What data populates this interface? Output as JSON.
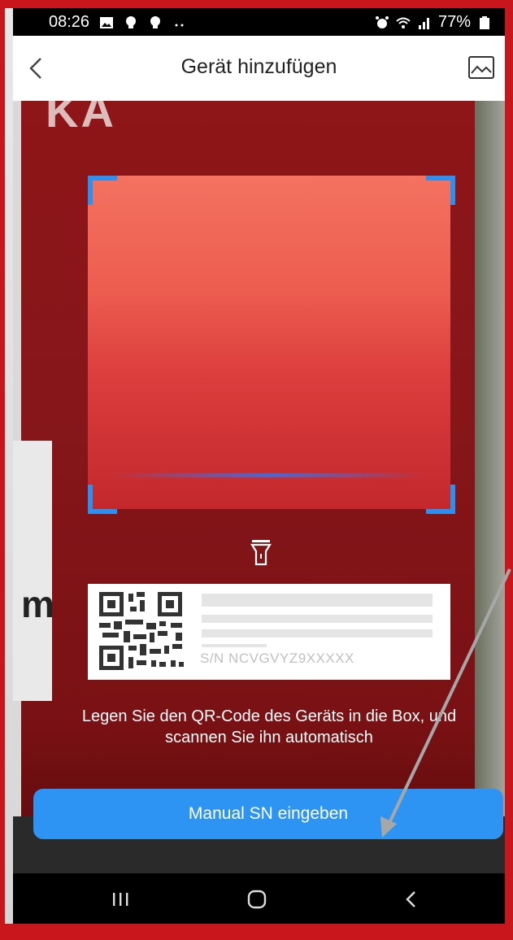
{
  "status_bar": {
    "time": "08:26",
    "battery": "77%",
    "icons_left": [
      "gallery-icon",
      "bulb-icon",
      "bulb-icon",
      "more-dots-icon"
    ],
    "icons_right": [
      "alarm-icon",
      "wifi-icon",
      "signal-icon",
      "battery-icon"
    ]
  },
  "header": {
    "title": "Gerät hinzufügen",
    "back_icon": "chevron-left-icon",
    "gallery_icon": "image-icon"
  },
  "camera": {
    "box_text": "KA",
    "panel_text": "m"
  },
  "scanner": {
    "torch_icon": "flashlight-icon",
    "sample_sn": "S/N  NCVGVYZ9XXXXX",
    "instruction": "Legen Sie den QR-Code des Geräts in die Box, und scannen Sie ihn automatisch"
  },
  "manual_button": {
    "label": "Manual SN eingeben"
  },
  "nav_bar": {
    "items": [
      "recent-apps-icon",
      "home-icon",
      "back-icon"
    ]
  },
  "colors": {
    "accent": "#2e94f4",
    "frame_red": "#c9161c"
  }
}
